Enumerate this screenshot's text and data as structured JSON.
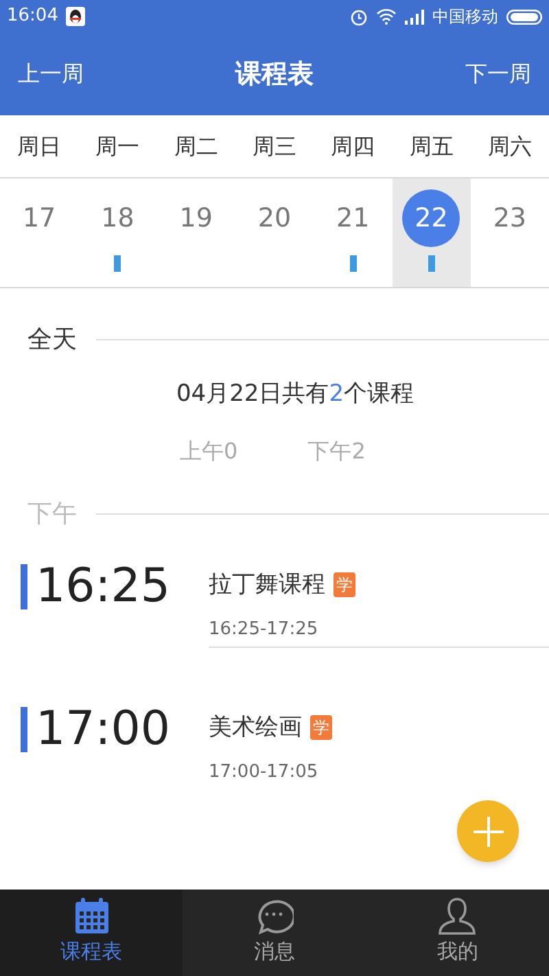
{
  "status_bar": {
    "time": "16:04",
    "carrier": "中国移动"
  },
  "nav": {
    "prev": "上一周",
    "title": "课程表",
    "next": "下一周"
  },
  "days": [
    {
      "weekday": "周日",
      "date": "17",
      "selected": false,
      "has_course": false
    },
    {
      "weekday": "周一",
      "date": "18",
      "selected": false,
      "has_course": true
    },
    {
      "weekday": "周二",
      "date": "19",
      "selected": false,
      "has_course": false
    },
    {
      "weekday": "周三",
      "date": "20",
      "selected": false,
      "has_course": false
    },
    {
      "weekday": "周四",
      "date": "21",
      "selected": false,
      "has_course": true
    },
    {
      "weekday": "周五",
      "date": "22",
      "selected": true,
      "has_course": true
    },
    {
      "weekday": "周六",
      "date": "23",
      "selected": false,
      "has_course": false
    }
  ],
  "all_day": {
    "heading": "全天",
    "summary_prefix": "04月22日共有",
    "summary_count": "2",
    "summary_suffix": "个课程",
    "am_count": "上午0",
    "pm_count": "下午2"
  },
  "afternoon": {
    "heading": "下午",
    "courses": [
      {
        "start": "16:25",
        "title": "拉丁舞课程",
        "badge": "学",
        "range": "16:25-17:25"
      },
      {
        "start": "17:00",
        "title": "美术绘画",
        "badge": "学",
        "range": "17:00-17:05"
      }
    ]
  },
  "tabs": [
    {
      "kind": "calendar",
      "label": "课程表",
      "selected": true
    },
    {
      "kind": "message",
      "label": "消息",
      "selected": false
    },
    {
      "kind": "person",
      "label": "我的",
      "selected": false
    }
  ]
}
